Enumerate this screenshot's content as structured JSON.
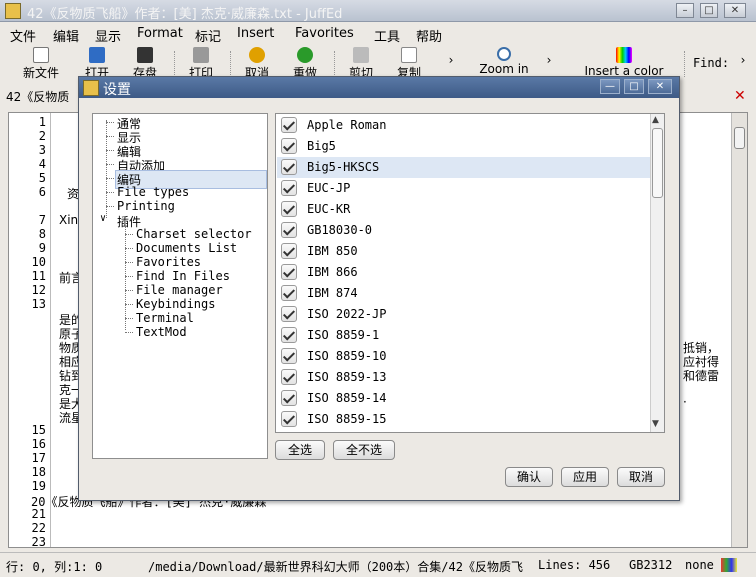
{
  "window": {
    "title": "42《反物质飞船》作者：[美] 杰克·威廉森.txt - JuffEd",
    "min": "–",
    "max": "□",
    "close": "✕"
  },
  "menu": [
    "文件",
    "编辑",
    "显示",
    "Format",
    "标记",
    "Insert",
    "Favorites",
    "工具",
    "帮助"
  ],
  "toolbar": {
    "new": "新文件",
    "open": "打开",
    "save": "存盘",
    "print": "打印",
    "undo": "取消",
    "redo": "重做",
    "cut": "剪切",
    "copy": "复制",
    "zoom": "Zoom in",
    "color": "Insert a color",
    "find": "Find:",
    "more": "›"
  },
  "tab": {
    "label": "42《反物质",
    "close": "✕"
  },
  "editor": {
    "line_numbers": [
      "1",
      "2",
      "3",
      "4",
      "5",
      "6",
      "7",
      "8",
      "9",
      "10",
      "11",
      "12",
      "13",
      "14",
      "15",
      "16",
      "17",
      "18",
      "19",
      "20",
      "21",
      "22",
      "23"
    ],
    "text": {
      "l6": "资",
      "l8": "Xin",
      "l12": "前言",
      "w1": "是的",
      "w2": "原子",
      "w3": "物质",
      "w4": "相应",
      "w5": "钻到",
      "w6": "克一",
      "w7": "是大",
      "w8": "流星",
      "r1": "抵销，",
      "r2": "应衬得",
      "r3": "和德雷",
      "r4": "·",
      "l20": "20《反物质飞船》作者：[美] 杰克·威廉森"
    }
  },
  "status": {
    "position": "行: 0, 列:1: 0",
    "path": "/media/Download/最新世界科幻大师（200本）合集/42《反物质飞",
    "lines": "Lines: 456",
    "encoding": "GB2312",
    "eol": "none"
  },
  "dialog": {
    "title": "设置",
    "min": "—",
    "max": "□",
    "close": "✕",
    "tree": {
      "items": [
        "通常",
        "显示",
        "编辑",
        "自动添加",
        "编码",
        "File types",
        "Printing",
        "插件"
      ],
      "plugins": [
        "Charset selector",
        "Documents List",
        "Favorites",
        "Find In Files",
        "File manager",
        "Keybindings",
        "Terminal",
        "TextMod"
      ],
      "expander": "∨"
    },
    "encodings": [
      "Apple Roman",
      "Big5",
      "Big5-HKSCS",
      "EUC-JP",
      "EUC-KR",
      "GB18030-0",
      "IBM 850",
      "IBM 866",
      "IBM 874",
      "ISO 2022-JP",
      "ISO 8859-1",
      "ISO 8859-10",
      "ISO 8859-13",
      "ISO 8859-14",
      "ISO 8859-15"
    ],
    "selected_encoding": "Big5-HKSCS",
    "select_all": "全选",
    "select_none": "全不选",
    "ok": "确认",
    "apply": "应用",
    "cancel": "取消",
    "scroll_up": "▲",
    "scroll_down": "▼"
  },
  "colors": {
    "dialog_title": "#3d5a86",
    "selection": "#dde7f4",
    "close_red": "#cc0000"
  }
}
